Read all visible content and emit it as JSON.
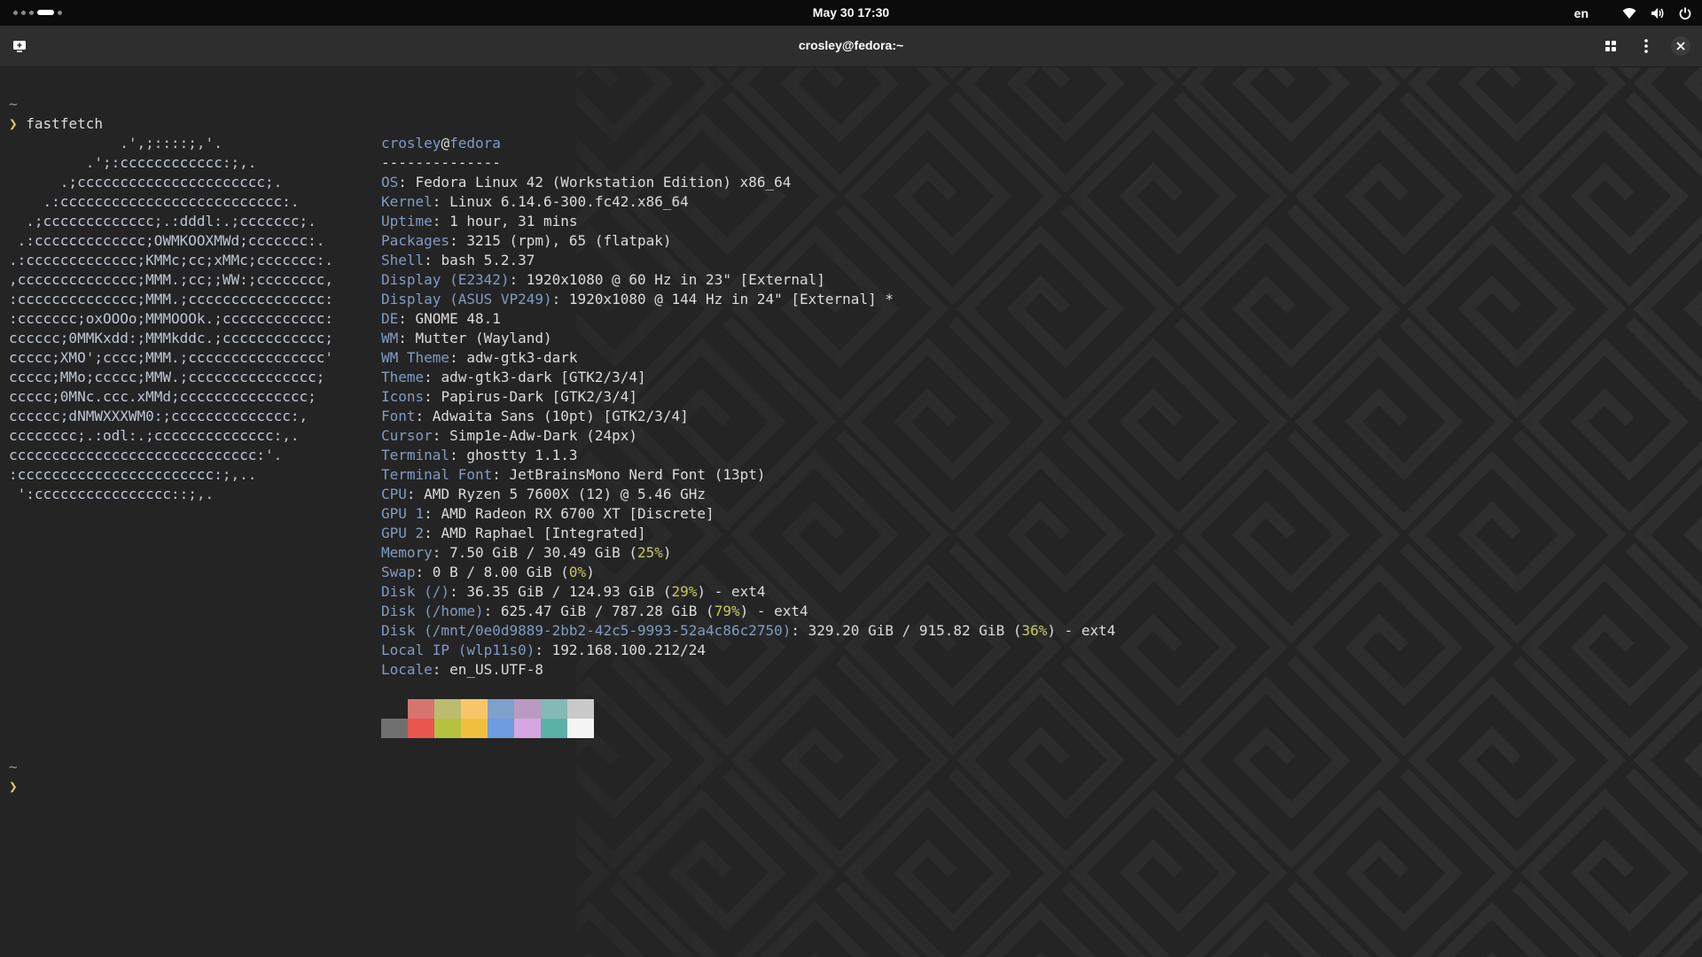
{
  "topbar": {
    "clock": "May 30  17:30",
    "lang": "en",
    "icons": [
      "activities-indicator",
      "wifi-icon",
      "volume-icon",
      "power-icon"
    ]
  },
  "window": {
    "title": "crosley@fedora:~",
    "icons": [
      "new-tab-icon",
      "tab-overview-icon",
      "menu-icon",
      "close-icon"
    ]
  },
  "terminal": {
    "tilde1": "~",
    "prompt_symbol": "❯",
    "command": "fastfetch",
    "ascii_logo": [
      "             .',;::::;,'.",
      "         .';:cccccccccccc:;,.",
      "      .;cccccccccccccccccccccc;.",
      "    .:cccccccccccccccccccccccccc:.",
      "  .;ccccccccccccc;.:dddl:.;ccccccc;.",
      " .:ccccccccccccc;OWMKOOXMWd;ccccccc:.",
      ".:ccccccccccccc;KMMc;cc;xMMc;ccccccc:.",
      ",cccccccccccccc;MMM.;cc;;WW:;cccccccc,",
      ":cccccccccccccc;MMM.;cccccccccccccccc:",
      ":ccccccc;oxOOOo;MMMOOOk.;cccccccccccc:",
      "cccccc;0MMKxdd:;MMMkddc.;cccccccccccc;",
      "ccccc;XMO';cccc;MMM.;cccccccccccccccc'",
      "ccccc;MMo;ccccc;MMW.;ccccccccccccccc;",
      "ccccc;0MNc.ccc.xMMd;ccccccccccccccc;",
      "cccccc;dNMWXXXWM0:;cccccccccccccc:,",
      "cccccccc;.:odl:.;cccccccccccccc:,.",
      "ccccccccccccccccccccccccccccc:'.",
      ":ccccccccccccccccccccccc:;,..",
      " ':cccccccccccccccc::;,."
    ],
    "user": "crosley",
    "at": "@",
    "host": "fedora",
    "separator": "--------------",
    "info": [
      {
        "key": "OS",
        "value": ": Fedora Linux 42 (Workstation Edition) x86_64"
      },
      {
        "key": "Kernel",
        "value": ": Linux 6.14.6-300.fc42.x86_64"
      },
      {
        "key": "Uptime",
        "value": ": 1 hour, 31 mins"
      },
      {
        "key": "Packages",
        "value": ": 3215 (rpm), 65 (flatpak)"
      },
      {
        "key": "Shell",
        "value": ": bash 5.2.37"
      },
      {
        "key": "Display (E2342)",
        "value": ": 1920x1080 @ 60 Hz in 23\" [External]"
      },
      {
        "key": "Display (ASUS VP249)",
        "value": ": 1920x1080 @ 144 Hz in 24\" [External] *"
      },
      {
        "key": "DE",
        "value": ": GNOME 48.1"
      },
      {
        "key": "WM",
        "value": ": Mutter (Wayland)"
      },
      {
        "key": "WM Theme",
        "value": ": adw-gtk3-dark"
      },
      {
        "key": "Theme",
        "value": ": adw-gtk3-dark [GTK2/3/4]"
      },
      {
        "key": "Icons",
        "value": ": Papirus-Dark [GTK2/3/4]"
      },
      {
        "key": "Font",
        "value": ": Adwaita Sans (10pt) [GTK2/3/4]"
      },
      {
        "key": "Cursor",
        "value": ": Simp1e-Adw-Dark (24px)"
      },
      {
        "key": "Terminal",
        "value": ": ghostty 1.1.3"
      },
      {
        "key": "Terminal Font",
        "value": ": JetBrainsMono Nerd Font (13pt)"
      },
      {
        "key": "CPU",
        "value": ": AMD Ryzen 5 7600X (12) @ 5.46 GHz"
      },
      {
        "key": "GPU 1",
        "value": ": AMD Radeon RX 6700 XT [Discrete]"
      },
      {
        "key": "GPU 2",
        "value": ": AMD Raphael [Integrated]"
      },
      {
        "key": "Memory",
        "value": ": 7.50 GiB / 30.49 GiB (",
        "pct": "25%",
        "tail": ")"
      },
      {
        "key": "Swap",
        "value": ": 0 B / 8.00 GiB (",
        "pct": "0%",
        "tail": ")"
      },
      {
        "key": "Disk (/)",
        "value": ": 36.35 GiB / 124.93 GiB (",
        "pct": "29%",
        "tail": ") - ext4"
      },
      {
        "key": "Disk (/home)",
        "value": ": 625.47 GiB / 787.28 GiB (",
        "pct": "79%",
        "tail": ") - ext4"
      },
      {
        "key": "Disk (/mnt/0e0d9889-2bb2-42c5-9993-52a4c86c2750)",
        "value": ": 329.20 GiB / 915.82 GiB (",
        "pct": "36%",
        "tail": ") - ext4"
      },
      {
        "key": "Local IP (wlp11s0)",
        "value": ": 192.168.100.212/24"
      },
      {
        "key": "Locale",
        "value": ": en_US.UTF-8"
      }
    ],
    "palette_top": [
      "#242424",
      "#d6756e",
      "#bcbb6f",
      "#f7c66a",
      "#7ea0cc",
      "#b99bc1",
      "#84b9b4",
      "#c9c9c9"
    ],
    "palette_bottom": [
      "#707070",
      "#e8564f",
      "#b6c23f",
      "#f1bf3f",
      "#6f9be0",
      "#d6a6e2",
      "#5bb1a6",
      "#f4f4f4"
    ],
    "tilde2": "~"
  },
  "colors": {
    "key": "#7f9cc4",
    "percent": "#c8c864",
    "prompt": "#e8c75a",
    "background": "#242424"
  }
}
